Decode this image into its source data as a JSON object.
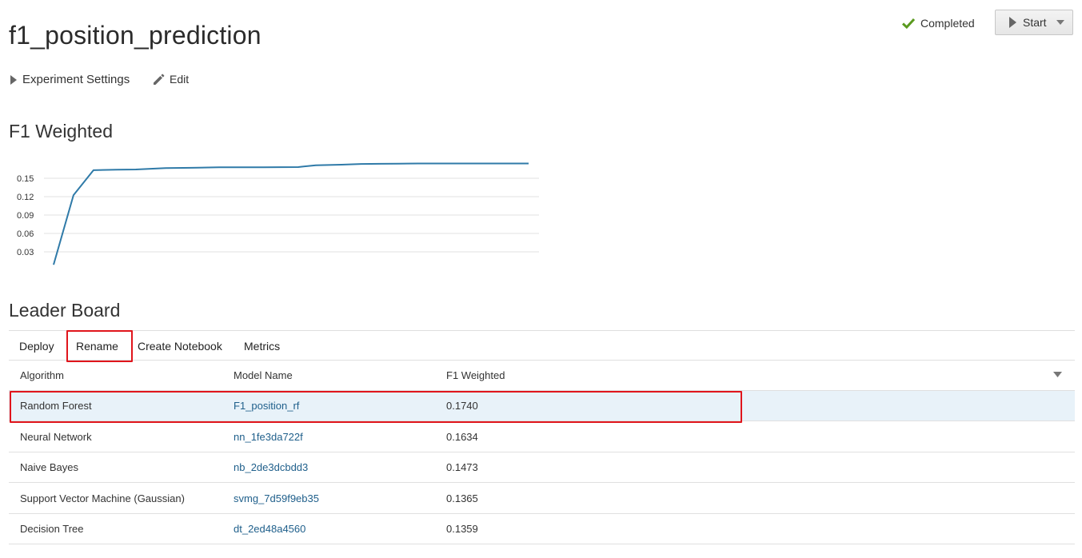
{
  "page": {
    "title": "f1_position_prediction",
    "status": "Completed",
    "start_label": "Start",
    "settings_label": "Experiment Settings",
    "edit_label": "Edit"
  },
  "colors": {
    "status_check": "#5a9a1f",
    "line": "#2f7aa8",
    "link": "#1f5f8b",
    "highlight": "#e0151c",
    "selected_row": "#e8f2f9"
  },
  "icons": {
    "status": "check-icon",
    "start": "play-icon",
    "start_menu": "caret-down-icon",
    "settings": "triangle-right-icon",
    "edit": "pencil-icon",
    "sort": "caret-down-icon"
  },
  "chart_title": "F1 Weighted",
  "chart_data": {
    "type": "line",
    "title": "F1 Weighted",
    "xlabel": "",
    "ylabel": "",
    "yticks": [
      "0.03",
      "0.06",
      "0.09",
      "0.12",
      "0.15"
    ],
    "ylim": [
      0,
      0.165
    ],
    "x": [
      0,
      0.042,
      0.084,
      0.133,
      0.173,
      0.236,
      0.291,
      0.348,
      0.397,
      0.442,
      0.476,
      0.515,
      0.552,
      0.606,
      0.647,
      0.688,
      0.726,
      0.768,
      0.809,
      0.848,
      0.894,
      0.948,
      1
    ],
    "series": [
      {
        "values": [
          0.009,
          0.1225,
          0.1632,
          0.1641,
          0.1643,
          0.1667,
          0.1671,
          0.1678,
          0.1679,
          0.168,
          0.1681,
          0.1682,
          0.1713,
          0.1722,
          0.1733,
          0.1736,
          0.1739,
          0.1741,
          0.1741,
          0.1741,
          0.1741,
          0.1741,
          0.1741
        ]
      }
    ],
    "grid": true,
    "legend": "none"
  },
  "leaderboard": {
    "title": "Leader Board",
    "toolbar": [
      "Deploy",
      "Rename",
      "Create Notebook",
      "Metrics"
    ],
    "columns": [
      "Algorithm",
      "Model Name",
      "F1 Weighted"
    ],
    "rows": [
      {
        "algorithm": "Random Forest",
        "model": "F1_position_rf",
        "score": "0.1740"
      },
      {
        "algorithm": "Neural Network",
        "model": "nn_1fe3da722f",
        "score": "0.1634"
      },
      {
        "algorithm": "Naive Bayes",
        "model": "nb_2de3dcbdd3",
        "score": "0.1473"
      },
      {
        "algorithm": "Support Vector Machine (Gaussian)",
        "model": "svmg_7d59f9eb35",
        "score": "0.1365"
      },
      {
        "algorithm": "Decision Tree",
        "model": "dt_2ed48a4560",
        "score": "0.1359"
      }
    ]
  }
}
